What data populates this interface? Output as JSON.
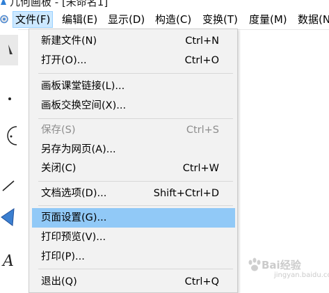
{
  "window": {
    "title": "几何画板 - [未命名1]"
  },
  "menubar": {
    "items": [
      {
        "label": "文件(F)"
      },
      {
        "label": "编辑(E)"
      },
      {
        "label": "显示(D)"
      },
      {
        "label": "构造(C)"
      },
      {
        "label": "变换(T)"
      },
      {
        "label": "度量(M)"
      },
      {
        "label": "数据(N)"
      }
    ],
    "active_index": 0
  },
  "file_menu": {
    "items": [
      {
        "label": "新建文件(N)",
        "shortcut": "Ctrl+N",
        "enabled": true
      },
      {
        "label": "打开(O)...",
        "shortcut": "Ctrl+O",
        "enabled": true
      },
      {
        "label": "画板课堂链接(L)...",
        "shortcut": "",
        "enabled": true
      },
      {
        "label": "画板交换空间(X)...",
        "shortcut": "",
        "enabled": true
      },
      {
        "label": "保存(S)",
        "shortcut": "Ctrl+S",
        "enabled": false
      },
      {
        "label": "另存为网页(A)...",
        "shortcut": "",
        "enabled": true
      },
      {
        "label": "关闭(C)",
        "shortcut": "Ctrl+W",
        "enabled": true
      },
      {
        "label": "文档选项(D)...",
        "shortcut": "Shift+Ctrl+D",
        "enabled": true
      },
      {
        "label": "页面设置(G)...",
        "shortcut": "",
        "enabled": true,
        "highlighted": true
      },
      {
        "label": "打印预览(V)...",
        "shortcut": "",
        "enabled": true
      },
      {
        "label": "打印(P)...",
        "shortcut": "",
        "enabled": true
      },
      {
        "label": "退出(Q)",
        "shortcut": "Ctrl+Q",
        "enabled": true
      }
    ]
  },
  "watermark": {
    "text": "Bai经验",
    "sub": "jingyan.baidu.com"
  },
  "colors": {
    "menu_background": "#f2f2f2",
    "highlight": "#91c9f7",
    "active_menubar": "#cce8ff",
    "disabled_text": "#8d8d8d"
  }
}
